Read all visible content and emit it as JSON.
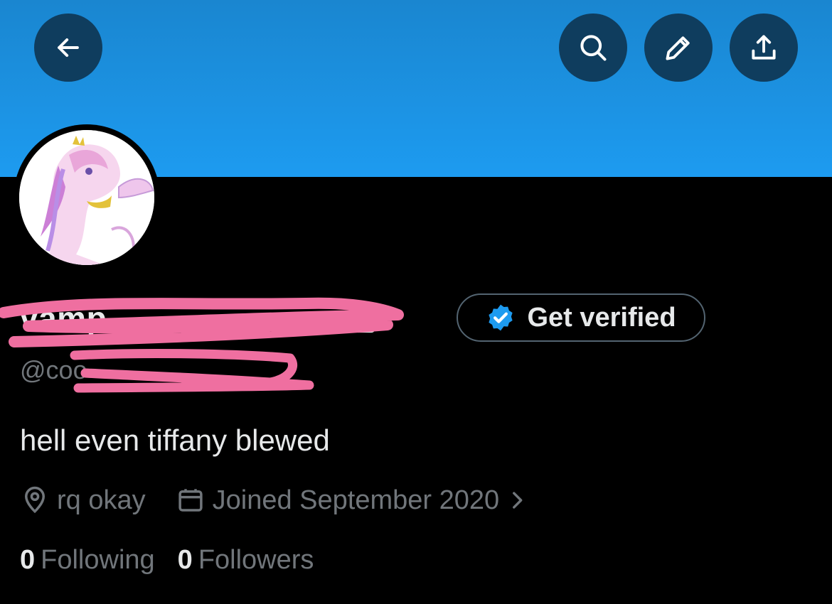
{
  "colors": {
    "banner": "#1d9bf0",
    "button_bg": "#0f3d5e",
    "background": "#000000",
    "text_primary": "#e7e9ea",
    "text_secondary": "#71767b",
    "verified_blue": "#1d9bf0",
    "redaction_pink": "#ef6fa0"
  },
  "header": {
    "back_icon": "arrow-left-icon",
    "search_icon": "search-icon",
    "edit_icon": "pencil-icon",
    "share_icon": "share-icon"
  },
  "profile": {
    "display_name": "vamp",
    "lock_icon": "lock-icon",
    "handle": "@coo",
    "bio": "hell even tiffany blewed",
    "get_verified_label": "Get verified",
    "location": "rq okay",
    "joined": "Joined September 2020",
    "following_count": "0",
    "following_label": "Following",
    "followers_count": "0",
    "followers_label": "Followers"
  }
}
